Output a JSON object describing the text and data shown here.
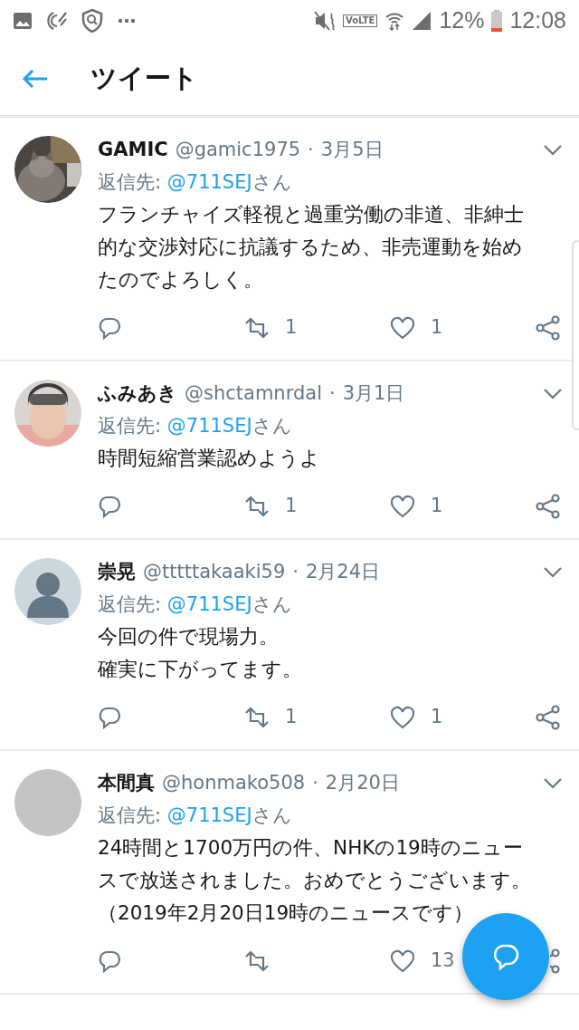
{
  "status_bar": {
    "volte": "VoLTE",
    "battery_text": "12%",
    "time": "12:08"
  },
  "header": {
    "title": "ツイート"
  },
  "tweets": [
    {
      "avatar": {
        "kind": "cat"
      },
      "name": "GAMIC",
      "handle": "@gamic1975",
      "separator": "·",
      "date": "3月5日",
      "reply_label": "返信先:",
      "reply_to": "@711SEJ",
      "reply_suffix": "さん",
      "text_lines": [
        "フランチャイズ軽視と過重労働の非道、非紳士",
        "的な交渉対応に抗議するため、非売運動を始め",
        "たのでよろしく。"
      ],
      "retweet_count": "1",
      "like_count": "1"
    },
    {
      "avatar": {
        "kind": "person"
      },
      "name": "ふみあき",
      "handle": "@shctamnrdal",
      "separator": "·",
      "date": "3月1日",
      "reply_label": "返信先:",
      "reply_to": "@711SEJ",
      "reply_suffix": "さん",
      "text_lines": [
        "時間短縮営業認めようよ"
      ],
      "retweet_count": "1",
      "like_count": "1"
    },
    {
      "avatar": {
        "kind": "default"
      },
      "name": "崇晃",
      "handle": "@tttttakaaki59",
      "separator": "·",
      "date": "2月24日",
      "reply_label": "返信先:",
      "reply_to": "@711SEJ",
      "reply_suffix": "さん",
      "text_lines": [
        "今回の件で現場力。",
        "確実に下がってます。"
      ],
      "retweet_count": "1",
      "like_count": "1"
    },
    {
      "avatar": {
        "kind": "blank"
      },
      "name": "本間真",
      "handle": "@honmako508",
      "separator": "·",
      "date": "2月20日",
      "reply_label": "返信先:",
      "reply_to": "@711SEJ",
      "reply_suffix": "さん",
      "text_lines": [
        "24時間と1700万円の件、NHKの19時のニュー",
        "スで放送されました。おめでとうございます。",
        "（2019年2月20日19時のニュースです）"
      ],
      "like_count": "13"
    }
  ]
}
